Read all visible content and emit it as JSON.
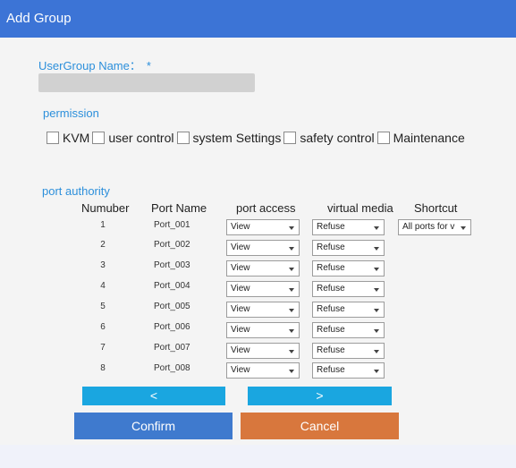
{
  "dialog": {
    "title": "Add Group"
  },
  "group_name": {
    "label": "UserGroup Name：",
    "required_mark": "*",
    "value": ""
  },
  "permission": {
    "label": "permission",
    "items": [
      {
        "label": "KVM",
        "checked": false
      },
      {
        "label": "user control",
        "checked": false
      },
      {
        "label": "system Settings",
        "checked": false
      },
      {
        "label": "safety control",
        "checked": false
      },
      {
        "label": "Maintenance",
        "checked": false
      }
    ]
  },
  "port_authority": {
    "label": "port authority",
    "columns": {
      "number": "Numuber",
      "name": "Port Name",
      "access": "port access",
      "media": "virtual media",
      "shortcut": "Shortcut"
    },
    "shortcut_value": "All ports for v",
    "rows": [
      {
        "number": "1",
        "name": "Port_001",
        "access": "View",
        "media": "Refuse"
      },
      {
        "number": "2",
        "name": "Port_002",
        "access": "View",
        "media": "Refuse"
      },
      {
        "number": "3",
        "name": "Port_003",
        "access": "View",
        "media": "Refuse"
      },
      {
        "number": "4",
        "name": "Port_004",
        "access": "View",
        "media": "Refuse"
      },
      {
        "number": "5",
        "name": "Port_005",
        "access": "View",
        "media": "Refuse"
      },
      {
        "number": "6",
        "name": "Port_006",
        "access": "View",
        "media": "Refuse"
      },
      {
        "number": "7",
        "name": "Port_007",
        "access": "View",
        "media": "Refuse"
      },
      {
        "number": "8",
        "name": "Port_008",
        "access": "View",
        "media": "Refuse"
      }
    ]
  },
  "pager": {
    "prev_label": "<",
    "next_label": ">"
  },
  "actions": {
    "confirm_label": "Confirm",
    "cancel_label": "Cancel"
  },
  "colors": {
    "title_bar": "#3c74d6",
    "accent_text": "#2c8fdb",
    "pager_button": "#1aa6e0",
    "confirm": "#3f7ace",
    "cancel": "#d8773d"
  }
}
